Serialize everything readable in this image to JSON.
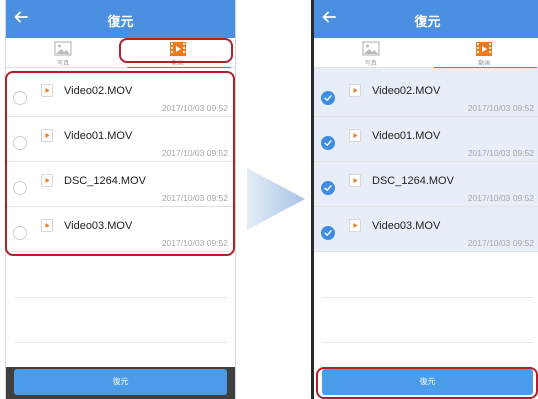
{
  "left": {
    "header": {
      "title": "復元"
    },
    "tabs": [
      {
        "label": "写真",
        "active": false
      },
      {
        "label": "動画",
        "active": true
      }
    ],
    "files": [
      {
        "name": "Video02.MOV",
        "date": "2017/10/03 09:52",
        "selected": false
      },
      {
        "name": "Video01.MOV",
        "date": "2017/10/03 09:52",
        "selected": false
      },
      {
        "name": "DSC_1264.MOV",
        "date": "2017/10/03 09:52",
        "selected": false
      },
      {
        "name": "Video03.MOV",
        "date": "2017/10/03 09:52",
        "selected": false
      }
    ],
    "restore_button": "復元"
  },
  "right": {
    "header": {
      "title": "復元"
    },
    "tabs": [
      {
        "label": "写真",
        "active": false
      },
      {
        "label": "動画",
        "active": true
      }
    ],
    "files": [
      {
        "name": "Video02.MOV",
        "date": "2017/10/03 09:52",
        "selected": true
      },
      {
        "name": "Video01.MOV",
        "date": "2017/10/03 09:52",
        "selected": true
      },
      {
        "name": "DSC_1264.MOV",
        "date": "2017/10/03 09:52",
        "selected": true
      },
      {
        "name": "Video03.MOV",
        "date": "2017/10/03 09:52",
        "selected": true
      }
    ],
    "restore_button": "復元"
  },
  "icons": {
    "back": "arrow-left-icon",
    "photo_tab": "image-icon",
    "video_tab": "film-icon",
    "file": "video-file-icon",
    "check": "checkmark-icon",
    "step_arrow": "arrow-right-icon"
  },
  "colors": {
    "header": "#4a8fe0",
    "accent": "#3f8ce2",
    "highlight": "#b0202a",
    "film": "#f07a1a"
  }
}
